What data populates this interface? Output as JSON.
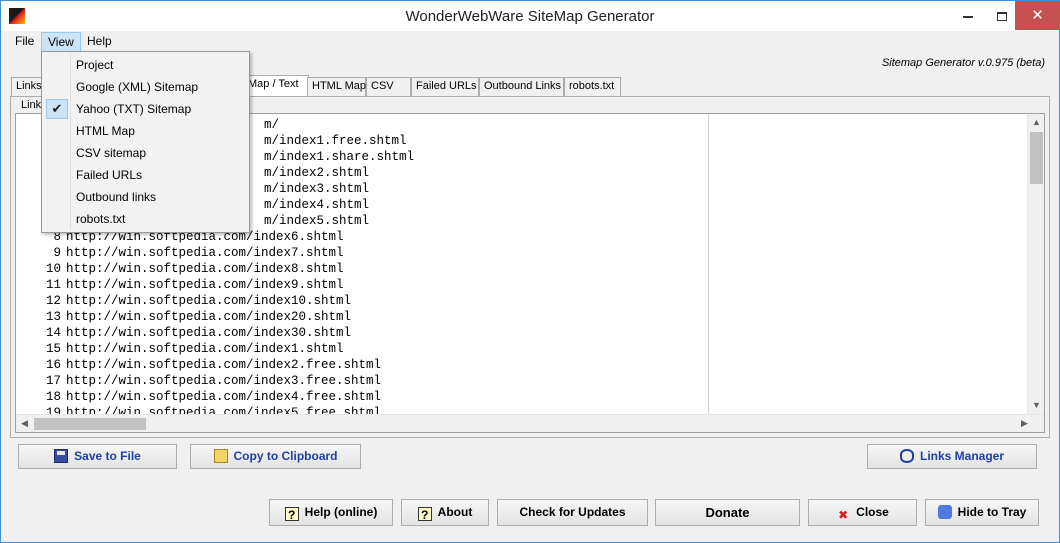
{
  "window": {
    "title": "WonderWebWare SiteMap Generator",
    "controls": {
      "minimize": "",
      "maximize": "",
      "close": "✕"
    }
  },
  "menubar": {
    "file": "File",
    "view": "View",
    "help": "Help"
  },
  "version_label": "Sitemap Generator v.0.975 (beta)",
  "tabs": [
    {
      "label": "Links"
    },
    {
      "label": "Map / Text"
    },
    {
      "label": "HTML Map"
    },
    {
      "label": "CSV"
    },
    {
      "label": "Failed URLs"
    },
    {
      "label": "Outbound Links"
    },
    {
      "label": "robots.txt"
    }
  ],
  "group_label": "Link",
  "view_menu": {
    "items": [
      {
        "label": "Project",
        "checked": false
      },
      {
        "label": "Google (XML) Sitemap",
        "checked": false
      },
      {
        "label": "Yahoo (TXT) Sitemap",
        "checked": true
      },
      {
        "label": "HTML Map",
        "checked": false
      },
      {
        "label": "CSV sitemap",
        "checked": false
      },
      {
        "label": "Failed URLs",
        "checked": false
      },
      {
        "label": "Outbound links",
        "checked": false
      },
      {
        "label": "robots.txt",
        "checked": false
      }
    ],
    "check_glyph": "✔"
  },
  "sitemap_lines": [
    {
      "num": "",
      "url": "m/"
    },
    {
      "num": "",
      "url": "m/index1.free.shtml"
    },
    {
      "num": "",
      "url": "m/index1.share.shtml"
    },
    {
      "num": "",
      "url": "m/index2.shtml"
    },
    {
      "num": "",
      "url": "m/index3.shtml"
    },
    {
      "num": "",
      "url": "m/index4.shtml"
    },
    {
      "num": "",
      "url": "m/index5.shtml"
    },
    {
      "num": "8",
      "url": "http://win.softpedia.com/index6.shtml"
    },
    {
      "num": "9",
      "url": "http://win.softpedia.com/index7.shtml"
    },
    {
      "num": "10",
      "url": "http://win.softpedia.com/index8.shtml"
    },
    {
      "num": "11",
      "url": "http://win.softpedia.com/index9.shtml"
    },
    {
      "num": "12",
      "url": "http://win.softpedia.com/index10.shtml"
    },
    {
      "num": "13",
      "url": "http://win.softpedia.com/index20.shtml"
    },
    {
      "num": "14",
      "url": "http://win.softpedia.com/index30.shtml"
    },
    {
      "num": "15",
      "url": "http://win.softpedia.com/index1.shtml"
    },
    {
      "num": "16",
      "url": "http://win.softpedia.com/index2.free.shtml"
    },
    {
      "num": "17",
      "url": "http://win.softpedia.com/index3.free.shtml"
    },
    {
      "num": "18",
      "url": "http://win.softpedia.com/index4.free.shtml"
    },
    {
      "num": "19",
      "url": "http://win.softpedia.com/index5.free.shtml"
    }
  ],
  "scroll": {
    "up": "▲",
    "down": "▼",
    "left": "◀",
    "right": "▶"
  },
  "actions": {
    "save_to_file": "Save to File",
    "copy_to_clipboard": "Copy to Clipboard",
    "links_manager": "Links Manager"
  },
  "footer": {
    "help_online": "Help (online)",
    "about": "About",
    "check_updates": "Check for Updates",
    "donate": "Donate",
    "close": "Close",
    "hide_to_tray": "Hide to Tray",
    "help_glyph": "?",
    "close_glyph": "✖"
  },
  "colors": {
    "accent_link": "#1f3ea8",
    "menu_highlight": "#cce4f7",
    "close_button": "#c75050"
  }
}
